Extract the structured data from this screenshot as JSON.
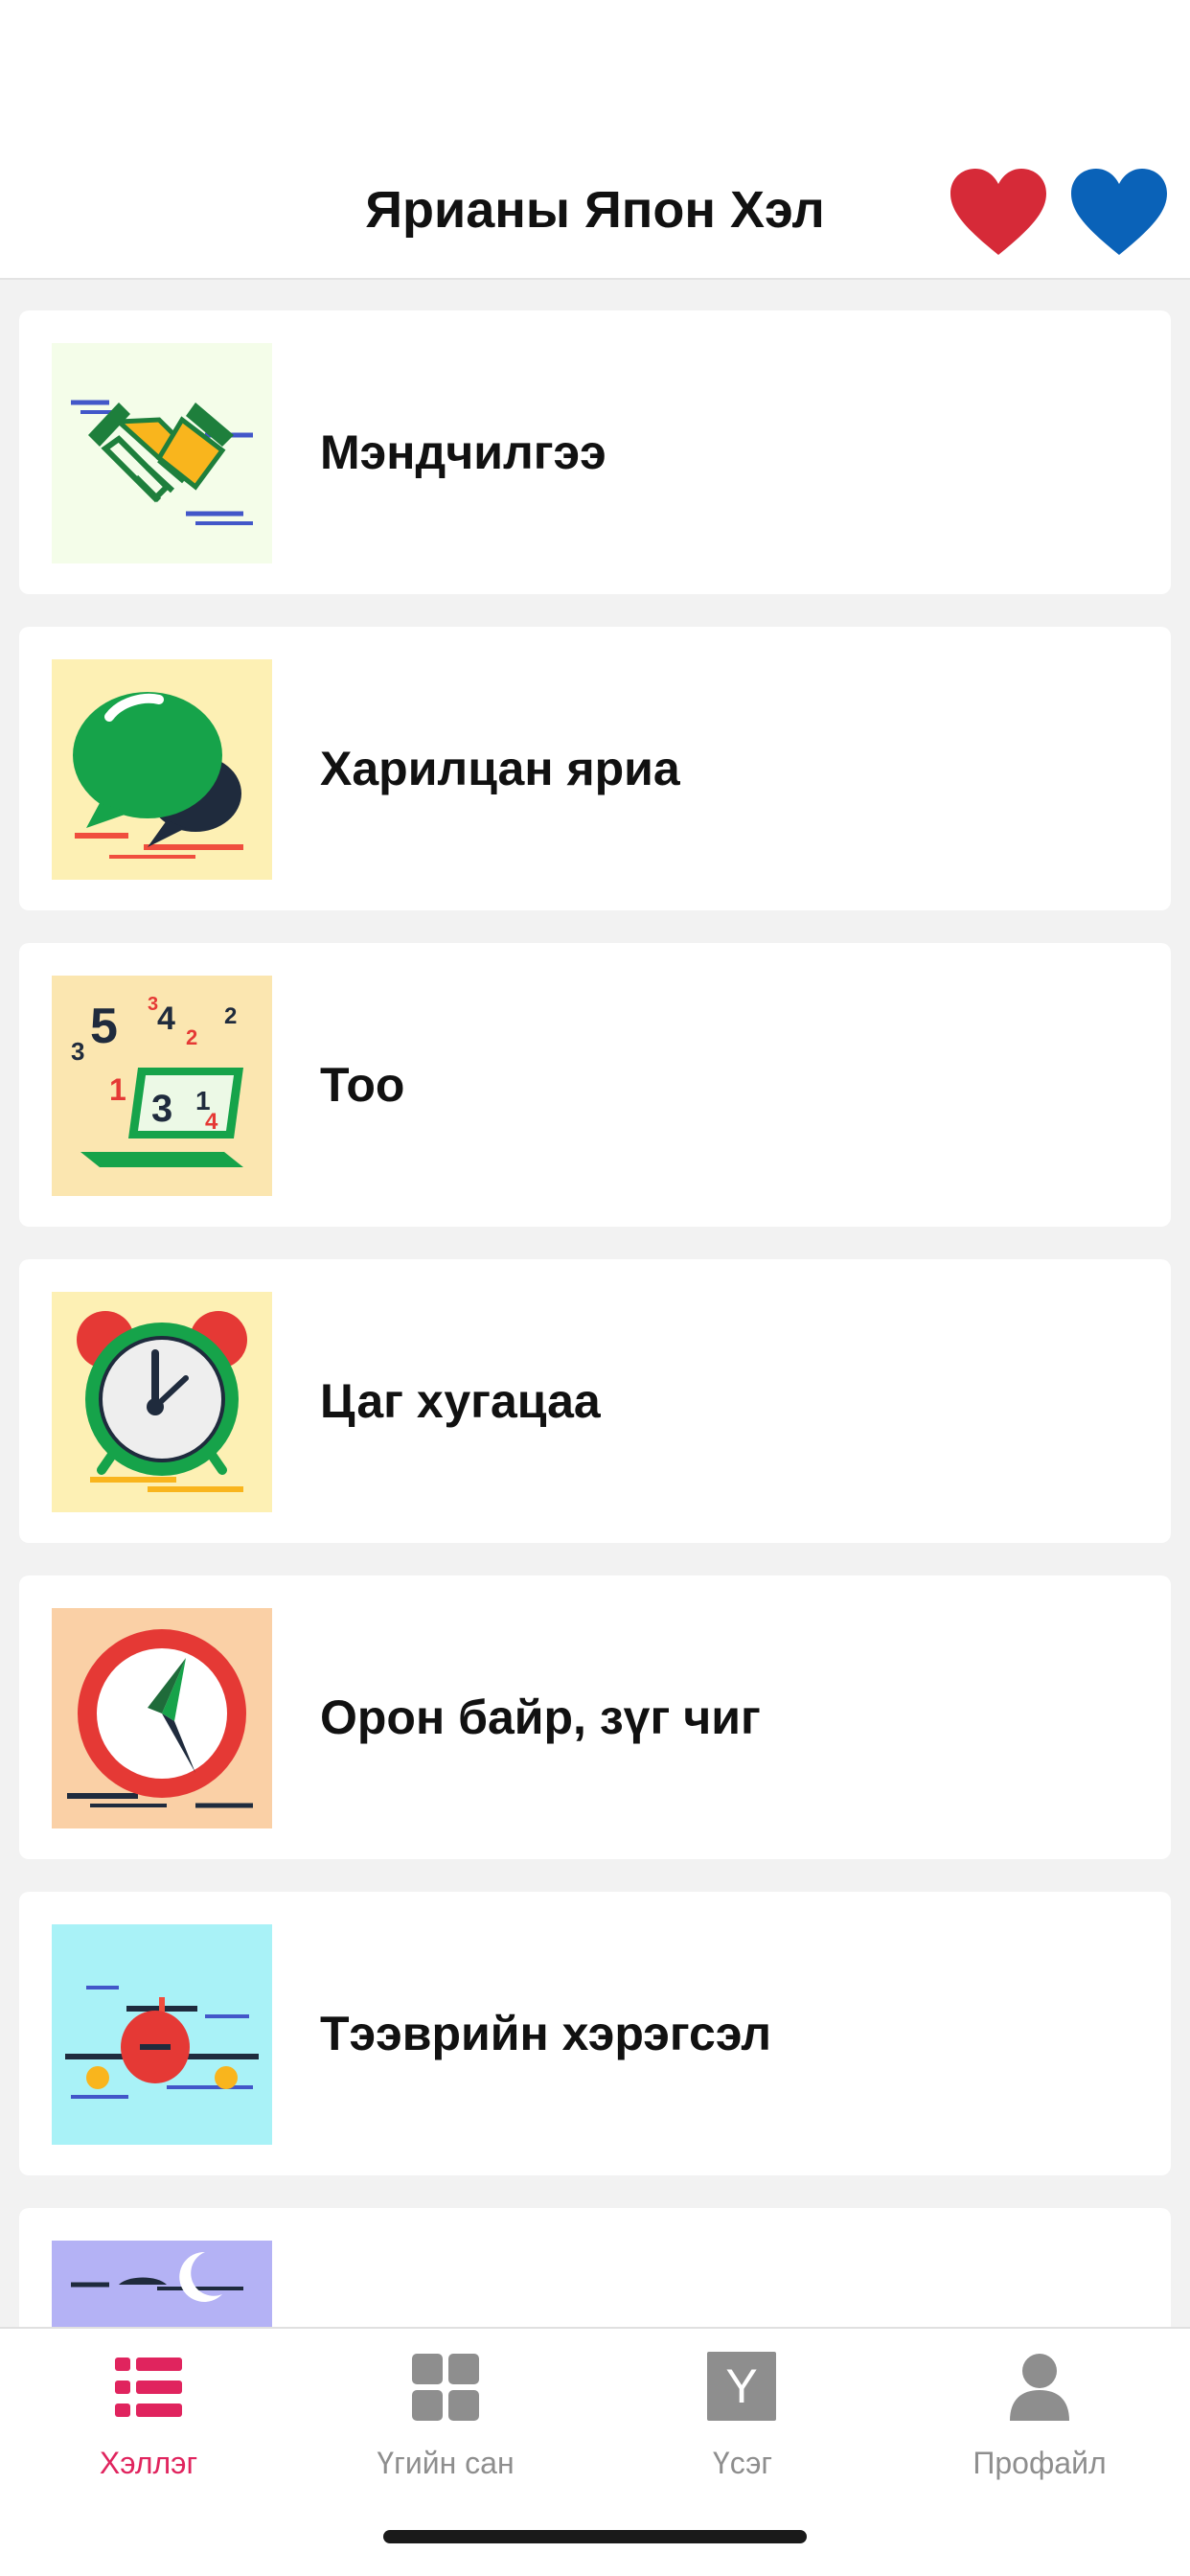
{
  "header": {
    "title": "Ярианы Япон Хэл",
    "favorites_red_icon": "heart-red-icon",
    "favorites_blue_icon": "heart-blue-icon",
    "red": "#d62a38",
    "blue": "#0a62b8"
  },
  "categories": [
    {
      "label": "Мэндчилгээ",
      "icon": "handshake-icon",
      "bg": "#f4fde9"
    },
    {
      "label": "Харилцан яриа",
      "icon": "chat-bubbles-icon",
      "bg": "#fdf0b4"
    },
    {
      "label": "Тоо",
      "icon": "numbers-laptop-icon",
      "bg": "#fbe6b0"
    },
    {
      "label": "Цаг хугацаа",
      "icon": "alarm-clock-icon",
      "bg": "#fdf0b4"
    },
    {
      "label": "Орон байр, зүг чиг",
      "icon": "compass-icon",
      "bg": "#fad0a6"
    },
    {
      "label": "Тээврийн хэрэгсэл",
      "icon": "airplane-icon",
      "bg": "#a9f2f7"
    },
    {
      "label": "",
      "icon": "night-moon-icon",
      "bg": "#b4b2f5"
    }
  ],
  "tabbar": {
    "accent": "#e0245e",
    "tabs": [
      {
        "label": "Хэллэг",
        "icon": "list-icon",
        "active": true
      },
      {
        "label": "Үгийн сан",
        "icon": "grid-icon",
        "active": false
      },
      {
        "label": "Үсэг",
        "icon": "letter-y-icon",
        "glyph": "Y",
        "active": false
      },
      {
        "label": "Профайл",
        "icon": "profile-icon",
        "active": false
      }
    ]
  }
}
